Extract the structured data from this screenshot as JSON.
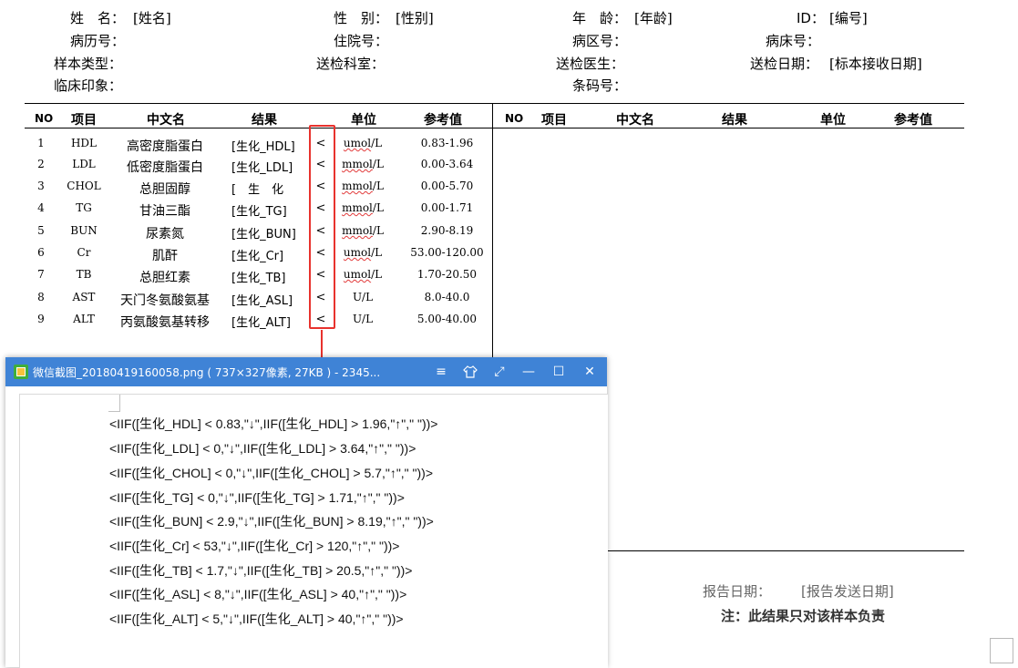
{
  "header": {
    "name_label": "姓　名：",
    "name_value": "[姓名]",
    "gender_label": "性　别：",
    "gender_value": "[性别]",
    "age_label": "年　龄：",
    "age_value": "[年龄]",
    "id_label": "ID：",
    "id_value": "[编号]",
    "record_label": "病历号：",
    "inpatient_label": "住院号：",
    "ward_label": "病区号：",
    "bed_label": "病床号：",
    "sample_label": "样本类型：",
    "dept_label": "送检科室：",
    "doctor_label": "送检医生：",
    "send_date_label": "送检日期：",
    "send_date_value": "[标本接收日期]",
    "clinical_label": "临床印象：",
    "barcode_label": "条码号："
  },
  "table": {
    "left_columns": [
      "NO",
      "项目",
      "中文名",
      "结果",
      "单位",
      "参考值"
    ],
    "right_columns": [
      "NO",
      "项目",
      "中文名",
      "结果",
      "单位",
      "参考值"
    ],
    "rows": [
      {
        "no": "1",
        "code": "HDL",
        "cn": "高密度脂蛋白",
        "result": "[生化_HDL]",
        "flag": "<",
        "unit": "umol/L",
        "ref": "0.83-1.96"
      },
      {
        "no": "2",
        "code": "LDL",
        "cn": "低密度脂蛋白",
        "result": "[生化_LDL]",
        "flag": "<",
        "unit": "mmol/L",
        "ref": "0.00-3.64"
      },
      {
        "no": "3",
        "code": "CHOL",
        "cn": "总胆固醇",
        "result": "[　生　化",
        "flag": "<",
        "unit": "mmol/L",
        "ref": "0.00-5.70"
      },
      {
        "no": "4",
        "code": "TG",
        "cn": "甘油三酯",
        "result": "[生化_TG]",
        "flag": "<",
        "unit": "mmol/L",
        "ref": "0.00-1.71"
      },
      {
        "no": "5",
        "code": "BUN",
        "cn": "尿素氮",
        "result": "[生化_BUN]",
        "flag": "<",
        "unit": "mmol/L",
        "ref": "2.90-8.19"
      },
      {
        "no": "6",
        "code": "Cr",
        "cn": "肌酐",
        "result": "[生化_Cr]",
        "flag": "<",
        "unit": "umol/L",
        "ref": "53.00-120.00"
      },
      {
        "no": "7",
        "code": "TB",
        "cn": "总胆红素",
        "result": "[生化_TB]",
        "flag": "<",
        "unit": "umol/L",
        "ref": "1.70-20.50"
      },
      {
        "no": "8",
        "code": "AST",
        "cn": "天门冬氨酸氨基",
        "result": "[生化_ASL]",
        "flag": "<",
        "unit": "U/L",
        "ref": "8.0-40.0"
      },
      {
        "no": "9",
        "code": "ALT",
        "cn": "丙氨酸氨基转移",
        "result": "[生化_ALT]",
        "flag": "<",
        "unit": "U/L",
        "ref": "5.00-40.00"
      }
    ]
  },
  "viewer": {
    "title": "微信截图_20180419160058.png ( 737×327像素, 27KB ) - 2345...",
    "formulas": [
      "<IIF([生化_HDL] < 0.83,\"↓\",IIF([生化_HDL] > 1.96,\"↑\",\" \"))>",
      "<IIF([生化_LDL] < 0,\"↓\",IIF([生化_LDL] > 3.64,\"↑\",\" \"))>",
      "<IIF([生化_CHOL] < 0,\"↓\",IIF([生化_CHOL] > 5.7,\"↑\",\" \"))>",
      "<IIF([生化_TG] < 0,\"↓\",IIF([生化_TG] > 1.71,\"↑\",\" \"))>",
      "<IIF([生化_BUN] < 2.9,\"↓\",IIF([生化_BUN] > 8.19,\"↑\",\" \"))>",
      "<IIF([生化_Cr] < 53,\"↓\",IIF([生化_Cr] > 120,\"↑\",\" \"))>",
      "<IIF([生化_TB] < 1.7,\"↓\",IIF([生化_TB] > 20.5,\"↑\",\" \"))>",
      "<IIF([生化_ASL] < 8,\"↓\",IIF([生化_ASL] > 40,\"↑\",\" \"))>",
      "<IIF([生化_ALT] < 5,\"↓\",IIF([生化_ALT] > 40,\"↑\",\" \"))>"
    ],
    "buttons": {
      "menu": "≡",
      "skin": "shirt-icon",
      "fullscreen": "⤢",
      "minimize": "—",
      "maximize": "☐",
      "close": "✕"
    }
  },
  "footer": {
    "report_date_label": "报告日期：",
    "report_date_value": "[报告发送日期]",
    "note": "注：此结果只对该样本负责"
  },
  "colors": {
    "annotation_red": "#e8322d",
    "titlebar_blue": "#3f83d6"
  }
}
